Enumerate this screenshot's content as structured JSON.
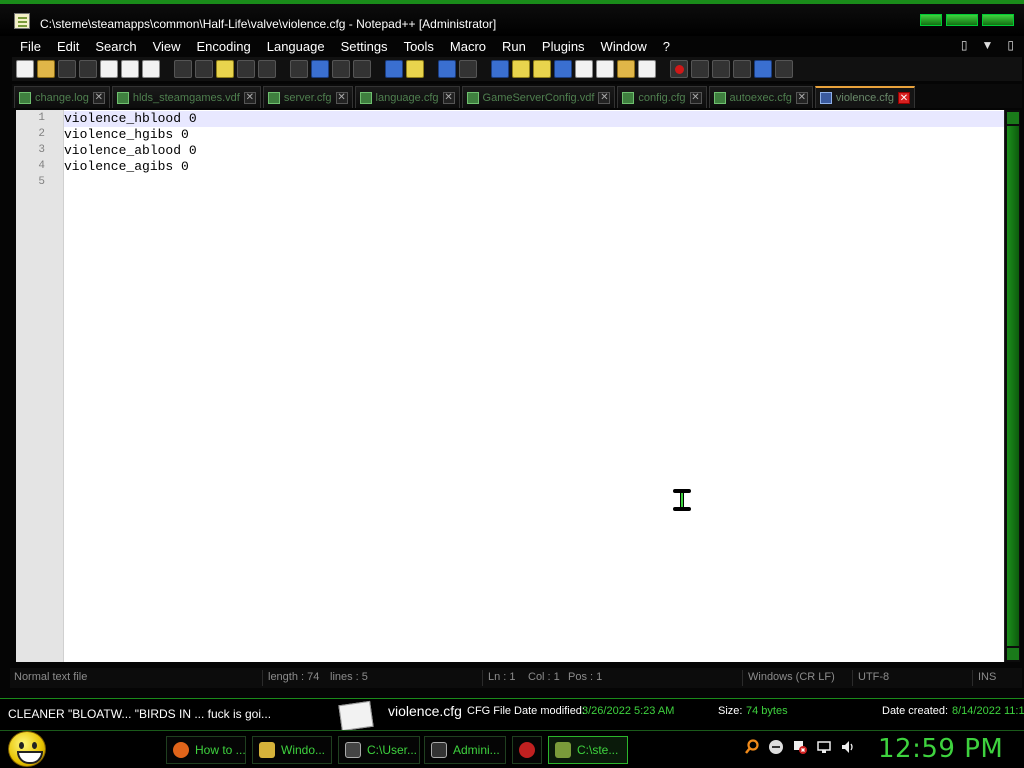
{
  "window": {
    "title": "C:\\steme\\steamapps\\common\\Half-Life\\valve\\violence.cfg - Notepad++ [Administrator]"
  },
  "menu": {
    "items": [
      "File",
      "Edit",
      "Search",
      "View",
      "Encoding",
      "Language",
      "Settings",
      "Tools",
      "Macro",
      "Run",
      "Plugins",
      "Window",
      "?"
    ],
    "right": [
      "▯",
      "▼",
      "▯"
    ]
  },
  "tabs": [
    {
      "label": "change.log",
      "active": false
    },
    {
      "label": "hlds_steamgames.vdf",
      "active": false
    },
    {
      "label": "server.cfg",
      "active": false
    },
    {
      "label": "language.cfg",
      "active": false
    },
    {
      "label": "GameServerConfig.vdf",
      "active": false
    },
    {
      "label": "config.cfg",
      "active": false
    },
    {
      "label": "autoexec.cfg",
      "active": false
    },
    {
      "label": "violence.cfg",
      "active": true
    }
  ],
  "editor": {
    "lines": [
      {
        "num": "1",
        "text": "violence_hblood 0"
      },
      {
        "num": "2",
        "text": "violence_hgibs 0"
      },
      {
        "num": "3",
        "text": "violence_ablood 0"
      },
      {
        "num": "4",
        "text": "violence_agibs 0"
      },
      {
        "num": "5",
        "text": ""
      }
    ]
  },
  "status": {
    "filetype": "Normal text file",
    "length": "length : 74",
    "lines": "lines : 5",
    "ln": "Ln : 1",
    "col": "Col : 1",
    "pos": "Pos : 1",
    "eol": "Windows (CR LF)",
    "encoding": "UTF-8",
    "mode": "INS"
  },
  "infostrip": {
    "left_text": "CLEANER   \"BLOATW...  \"BIRDS IN ...  fuck is goi...",
    "file_name": "violence.cfg",
    "file_type": "CFG File Date modified:",
    "date_modified": "3/26/2022 5:23 AM",
    "size_label": "Size:",
    "size": "74 bytes",
    "created_label": "Date created:",
    "created": "8/14/2022 11:1"
  },
  "taskbar": {
    "tasks": [
      {
        "label": "How to ...",
        "color": "#e0641a"
      },
      {
        "label": "Windo...",
        "color": "#d6b23a"
      },
      {
        "label": "C:\\User...",
        "color": "#444444"
      },
      {
        "label": "Admini...",
        "color": "#333333"
      },
      {
        "label": "",
        "color": "#c02020"
      },
      {
        "label": "C:\\ste...",
        "color": "#7a9b3a"
      }
    ],
    "clock": "12:59 PM"
  },
  "colors": {
    "accent": "#3ed23e",
    "active_tab_border": "#e8a23c"
  }
}
